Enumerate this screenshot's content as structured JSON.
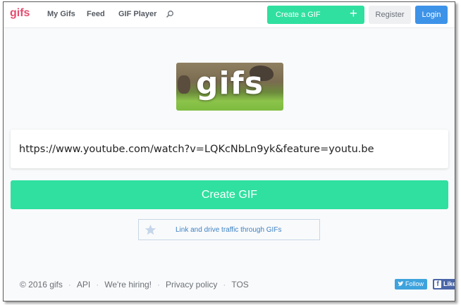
{
  "header": {
    "brand": "gifs",
    "nav": [
      "My Gifs",
      "Feed",
      "GIF Player"
    ],
    "create_label": "Create a GIF",
    "register_label": "Register",
    "login_label": "Login"
  },
  "hero": {
    "logo_text": "gifs"
  },
  "url_input": {
    "value": "https://www.youtube.com/watch?v=LQKcNbLn9yk&feature=youtu.be"
  },
  "main": {
    "create_label": "Create GIF",
    "promo_text": "Link and drive traffic through GIFs"
  },
  "footer": {
    "copyright": "© 2016 gifs",
    "links": [
      "API",
      "We're hiring!",
      "Privacy policy",
      "TOS"
    ],
    "twitter_label": "Follow",
    "facebook_label": "Like"
  },
  "colors": {
    "brand": "#e64c6e",
    "accent_green": "#2fe0a0",
    "login_blue": "#3d93e8"
  },
  "icons": {
    "search": "search-icon",
    "plus": "plus-icon",
    "star": "star-icon",
    "twitter": "twitter-bird-icon",
    "facebook": "facebook-icon"
  }
}
